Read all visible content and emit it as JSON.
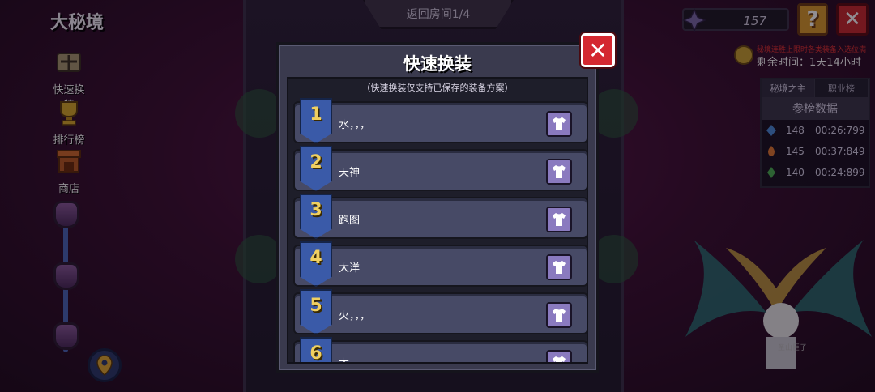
{
  "header": {
    "game_title": "大秘境",
    "room_indicator": "返回房间1/4",
    "currency_value": "157",
    "help_label": "?",
    "close_label": "✕"
  },
  "sidebar": {
    "items": [
      {
        "label": "快速换装",
        "icon": "armor-swap-icon"
      },
      {
        "label": "排行榜",
        "icon": "trophy-icon"
      },
      {
        "label": "商店",
        "icon": "shop-icon"
      }
    ]
  },
  "timer": {
    "note": "秘境连胜上限时各类装备入选位满",
    "remaining": "剩余时间：1天14小时"
  },
  "rank_panel": {
    "tabs": [
      "秘境之主",
      "职业榜"
    ],
    "title": "参榜数据",
    "rows": [
      {
        "points": "148",
        "time": "00:26:799",
        "color": "#4a8ad8"
      },
      {
        "points": "145",
        "time": "00:37:849",
        "color": "#e07830"
      },
      {
        "points": "140",
        "time": "00:24:899",
        "color": "#4ab050"
      }
    ]
  },
  "modal": {
    "title": "快速换装",
    "close_label": "✕",
    "hint": "（快速换装仅支持已保存的装备方案）",
    "slots": [
      {
        "num": "1",
        "name": "水，，，"
      },
      {
        "num": "2",
        "name": "天神"
      },
      {
        "num": "3",
        "name": "跑图"
      },
      {
        "num": "4",
        "name": "大洋"
      },
      {
        "num": "5",
        "name": "火，，，"
      },
      {
        "num": "6",
        "name": "木，，，"
      }
    ]
  },
  "boss": {
    "label": "圣山巨子"
  }
}
